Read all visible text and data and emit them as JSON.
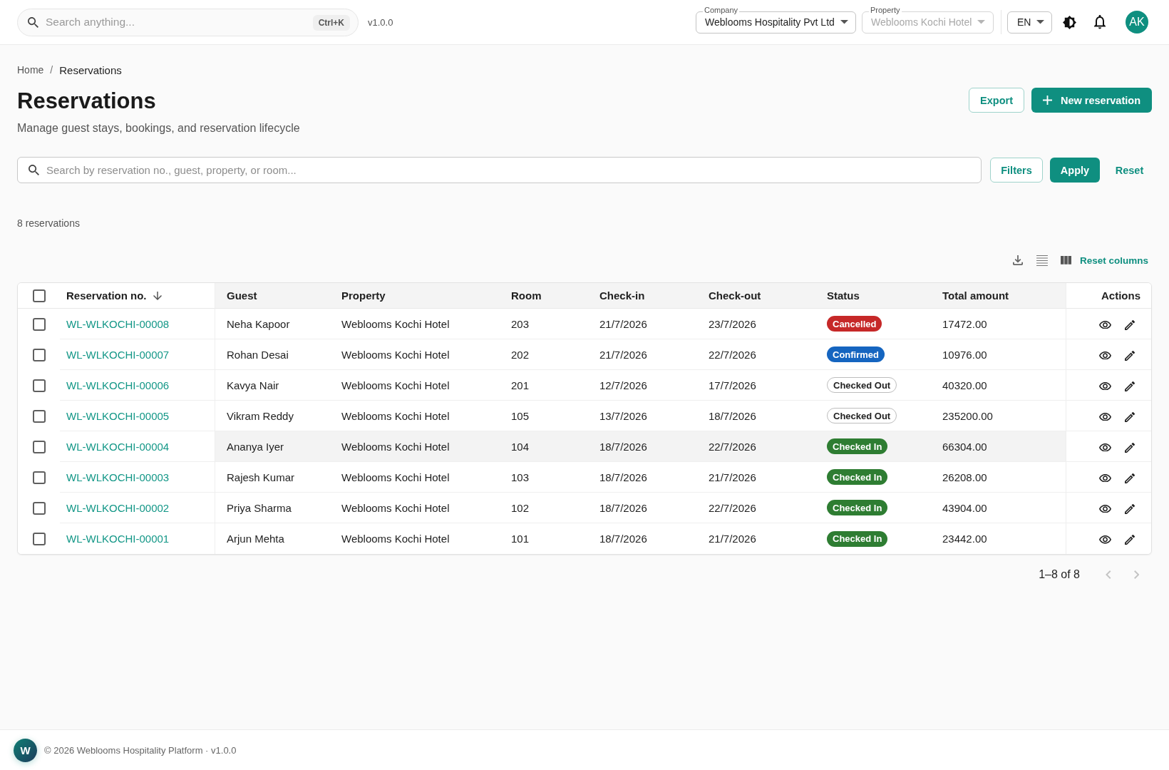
{
  "top_bar": {
    "search": {
      "placeholder": "Search anything...",
      "shortcut": "Ctrl+K"
    },
    "version": "v1.0.0",
    "company": {
      "label": "Company",
      "value": "Weblooms Hospitality Pvt Ltd",
      "disabled": false
    },
    "property": {
      "label": "Property",
      "value": "Weblooms Kochi Hotel",
      "disabled": true
    },
    "language": "EN",
    "avatar": "AK"
  },
  "breadcrumb": {
    "separator": "/",
    "items": [
      {
        "label": "Home",
        "current": false
      },
      {
        "label": "Reservations",
        "current": true
      }
    ]
  },
  "page": {
    "title": "Reservations",
    "subtitle": "Manage guest stays, bookings, and reservation lifecycle"
  },
  "header_buttons": [
    {
      "label": "Export",
      "kind": "outlined"
    },
    {
      "label": "New reservation",
      "kind": "primary"
    }
  ],
  "filter_bar": {
    "placeholder": "Search by reservation no., guest, property, or room...",
    "buttons": [
      {
        "label": "Filters",
        "kind": "outlined"
      },
      {
        "label": "Apply",
        "kind": "primary"
      },
      {
        "label": "Reset",
        "kind": "text"
      }
    ]
  },
  "result_count": "8 reservations",
  "table_toolbar": {
    "reset_columns": "Reset columns"
  },
  "table": {
    "select_all_checked": false,
    "columns": [
      {
        "label": "Reservation no.",
        "sorted": true
      },
      {
        "label": "Guest",
        "sorted": false
      },
      {
        "label": "Property",
        "sorted": false
      },
      {
        "label": "Room",
        "sorted": false
      },
      {
        "label": "Check-in",
        "sorted": false
      },
      {
        "label": "Check-out",
        "sorted": false
      },
      {
        "label": "Status",
        "sorted": false
      },
      {
        "label": "Total amount",
        "sorted": false
      },
      {
        "label": "Actions",
        "sorted": false
      }
    ],
    "rows": [
      {
        "checked": false,
        "highlighted": false,
        "reservation_no": "WL-WLKOCHI-00008",
        "guest": "Neha Kapoor",
        "property": "Weblooms Kochi Hotel",
        "room": "203",
        "check_in": "21/7/2026",
        "check_out": "23/7/2026",
        "status": {
          "label": "Cancelled",
          "kind": "filled",
          "color": "#c62828"
        },
        "total_amount": "17472.00"
      },
      {
        "checked": false,
        "highlighted": false,
        "reservation_no": "WL-WLKOCHI-00007",
        "guest": "Rohan Desai",
        "property": "Weblooms Kochi Hotel",
        "room": "202",
        "check_in": "21/7/2026",
        "check_out": "22/7/2026",
        "status": {
          "label": "Confirmed",
          "kind": "filled",
          "color": "#1565c0"
        },
        "total_amount": "10976.00"
      },
      {
        "checked": false,
        "highlighted": false,
        "reservation_no": "WL-WLKOCHI-00006",
        "guest": "Kavya Nair",
        "property": "Weblooms Kochi Hotel",
        "room": "201",
        "check_in": "12/7/2026",
        "check_out": "17/7/2026",
        "status": {
          "label": "Checked Out",
          "kind": "outlined",
          "color": "#ffffff"
        },
        "total_amount": "40320.00"
      },
      {
        "checked": false,
        "highlighted": false,
        "reservation_no": "WL-WLKOCHI-00005",
        "guest": "Vikram Reddy",
        "property": "Weblooms Kochi Hotel",
        "room": "105",
        "check_in": "13/7/2026",
        "check_out": "18/7/2026",
        "status": {
          "label": "Checked Out",
          "kind": "outlined",
          "color": "#ffffff"
        },
        "total_amount": "235200.00"
      },
      {
        "checked": false,
        "highlighted": true,
        "reservation_no": "WL-WLKOCHI-00004",
        "guest": "Ananya Iyer",
        "property": "Weblooms Kochi Hotel",
        "room": "104",
        "check_in": "18/7/2026",
        "check_out": "22/7/2026",
        "status": {
          "label": "Checked In",
          "kind": "filled",
          "color": "#2e7d32"
        },
        "total_amount": "66304.00"
      },
      {
        "checked": false,
        "highlighted": false,
        "reservation_no": "WL-WLKOCHI-00003",
        "guest": "Rajesh Kumar",
        "property": "Weblooms Kochi Hotel",
        "room": "103",
        "check_in": "18/7/2026",
        "check_out": "21/7/2026",
        "status": {
          "label": "Checked In",
          "kind": "filled",
          "color": "#2e7d32"
        },
        "total_amount": "26208.00"
      },
      {
        "checked": false,
        "highlighted": false,
        "reservation_no": "WL-WLKOCHI-00002",
        "guest": "Priya Sharma",
        "property": "Weblooms Kochi Hotel",
        "room": "102",
        "check_in": "18/7/2026",
        "check_out": "22/7/2026",
        "status": {
          "label": "Checked In",
          "kind": "filled",
          "color": "#2e7d32"
        },
        "total_amount": "43904.00"
      },
      {
        "checked": false,
        "highlighted": false,
        "reservation_no": "WL-WLKOCHI-00001",
        "guest": "Arjun Mehta",
        "property": "Weblooms Kochi Hotel",
        "room": "101",
        "check_in": "18/7/2026",
        "check_out": "21/7/2026",
        "status": {
          "label": "Checked In",
          "kind": "filled",
          "color": "#2e7d32"
        },
        "total_amount": "23442.00"
      }
    ]
  },
  "pagination": {
    "range": "1–8 of 8",
    "previous_disabled": true,
    "next_disabled": true
  },
  "footer": {
    "logo_letter": "W",
    "text": "© 2026 Weblooms Hospitality Platform · v1.0.0"
  }
}
